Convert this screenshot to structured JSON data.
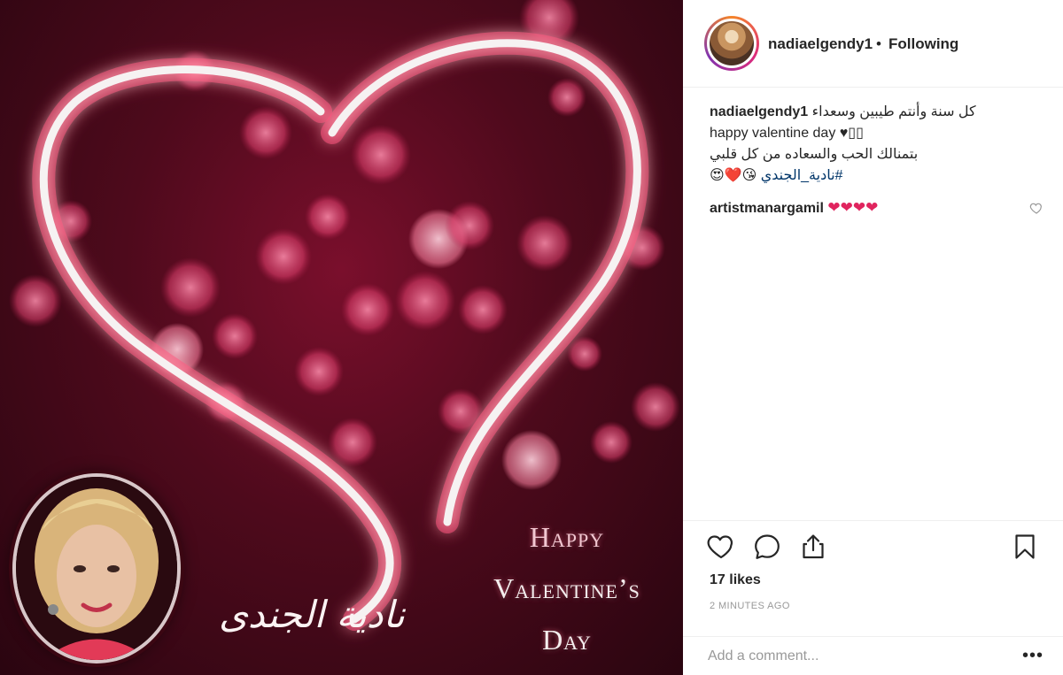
{
  "post": {
    "image_text": {
      "signature": "نادية الجندى",
      "line1": "Happy",
      "line2": "Valentine’s",
      "line3": "Day"
    }
  },
  "header": {
    "username": "nadiaelgendy1",
    "separator": "•",
    "follow_status": "Following"
  },
  "caption": {
    "username": "nadiaelgendy1",
    "line1": "كل سنة وأنتم طيبين وسعداء",
    "line2": "happy valentine day ♥▯▯",
    "line3": "بتمنالك الحب والسعاده من كل قلبي",
    "hashtag": "#نادية_الجندي",
    "emojis": "😘❤️😍"
  },
  "comments": [
    {
      "username": "artistmanargamil",
      "text": "❤❤❤❤"
    }
  ],
  "stats": {
    "likes": "17 likes",
    "time": "2 MINUTES AGO"
  },
  "add_comment": {
    "placeholder": "Add a comment...",
    "more": "•••"
  },
  "icons": {
    "like": "heart-icon",
    "comment": "comment-icon",
    "share": "share-icon",
    "save": "bookmark-icon",
    "comment_like": "heart-icon"
  },
  "colors": {
    "background_dark": "#4e0a1c",
    "heart_glow": "#ff3b6b",
    "link": "#003569",
    "muted": "#999999"
  }
}
